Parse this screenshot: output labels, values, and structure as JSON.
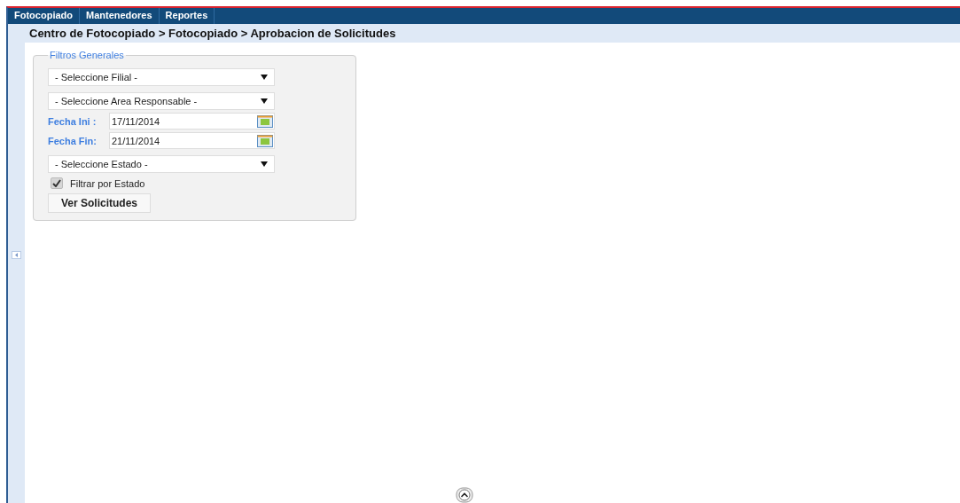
{
  "menu": [
    {
      "label": "Fotocopiado"
    },
    {
      "label": "Mantenedores"
    },
    {
      "label": "Reportes"
    }
  ],
  "breadcrumb": "Centro de Fotocopiado > Fotocopiado > Aprobacion de Solicitudes",
  "filters": {
    "legend": "Filtros Generales",
    "fields": [
      {
        "kind": "select",
        "value": "- Seleccione Filial -"
      },
      {
        "kind": "select",
        "value": "- Seleccione Area Responsable -"
      },
      {
        "kind": "date",
        "label": "Fecha Ini :",
        "value": "17/11/2014"
      },
      {
        "kind": "date",
        "label": "Fecha Fin:",
        "value": "21/11/2014"
      },
      {
        "kind": "select",
        "value": "- Seleccione Estado -"
      }
    ],
    "checkbox": {
      "label": "Filtrar por Estado",
      "checked": true
    },
    "button": "Ver Solicitudes"
  }
}
